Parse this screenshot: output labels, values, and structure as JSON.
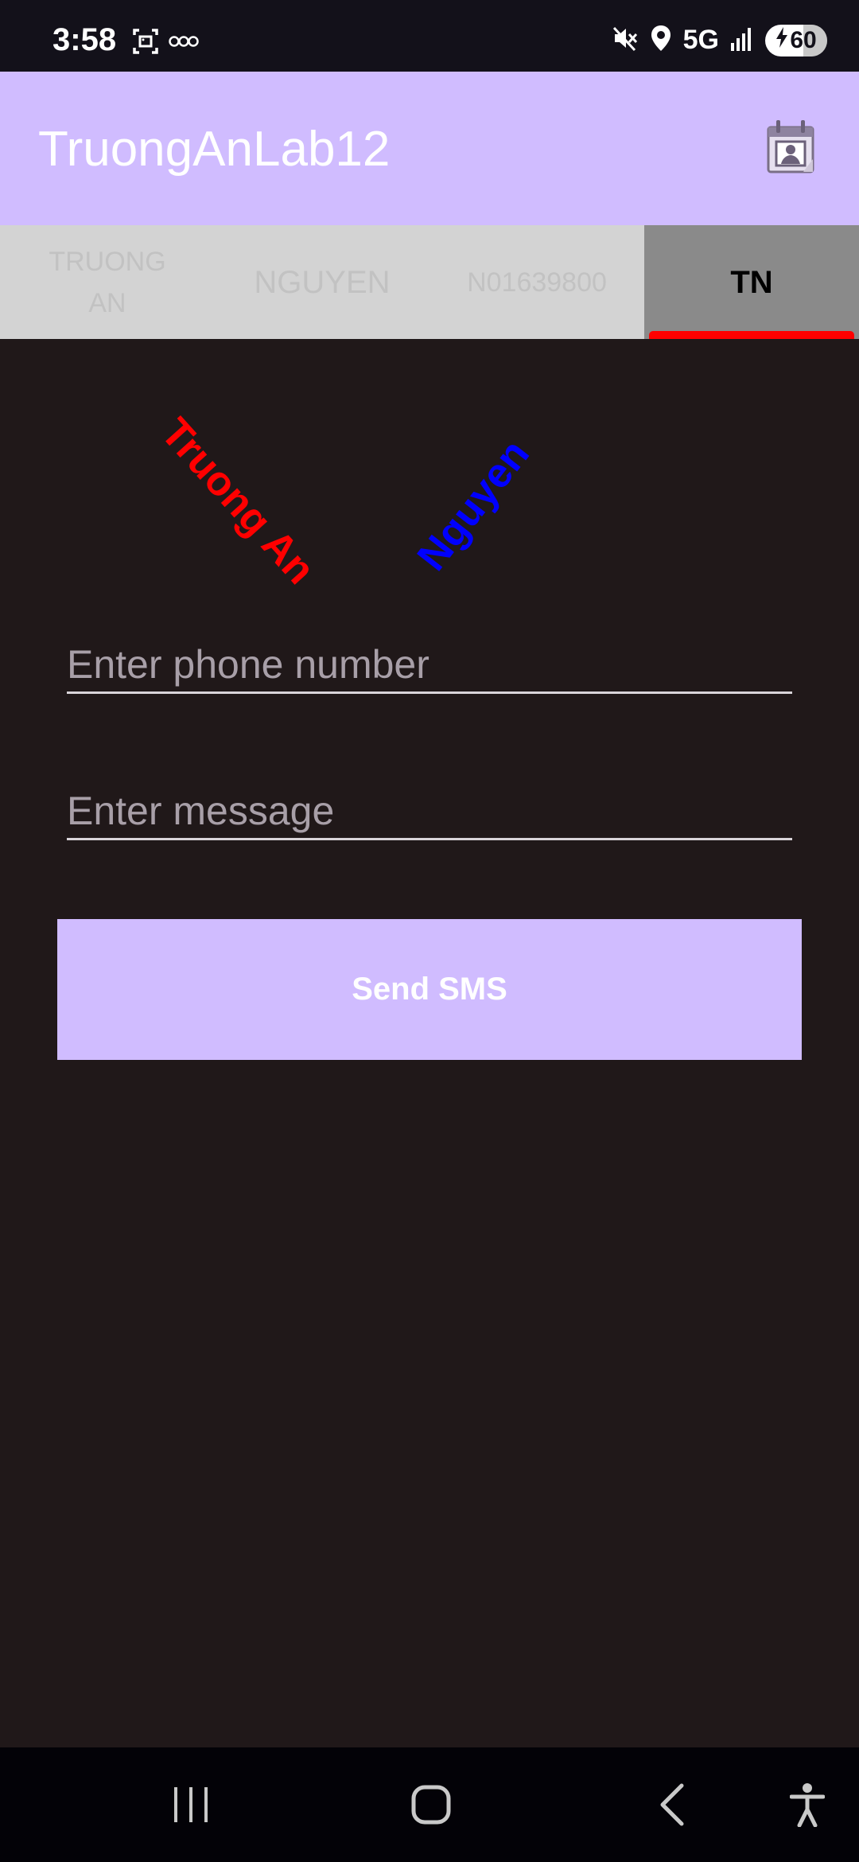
{
  "status_bar": {
    "time": "3:58",
    "left_icons": [
      "screenshot-icon",
      "voicemail-icon"
    ],
    "network": "5G",
    "battery": "60",
    "right_icons": [
      "mute-icon",
      "location-icon",
      "signal-icon",
      "battery-charging-icon"
    ]
  },
  "app_bar": {
    "title": "TruongAnLab12",
    "action_icon": "contact-calendar-icon"
  },
  "tabs": [
    {
      "label": "TRUONG AN",
      "active": false
    },
    {
      "label": "NGUYEN",
      "active": false
    },
    {
      "label": "N01639800",
      "active": false
    },
    {
      "label": "TN",
      "active": true
    }
  ],
  "rotated_texts": {
    "first": "Truong An",
    "second": "Nguyen"
  },
  "form": {
    "phone_placeholder": "Enter phone number",
    "phone_value": "",
    "message_placeholder": "Enter message",
    "message_value": "",
    "send_label": "Send SMS"
  },
  "colors": {
    "app_bar": "#d0bcff",
    "background": "#201819",
    "active_tab": "#8a8a8a",
    "indicator": "#ff0000",
    "text_red": "#ff0000",
    "text_blue": "#0000ff"
  },
  "nav_bar": {
    "icons": [
      "recents-icon",
      "home-icon",
      "back-icon",
      "accessibility-icon"
    ]
  }
}
